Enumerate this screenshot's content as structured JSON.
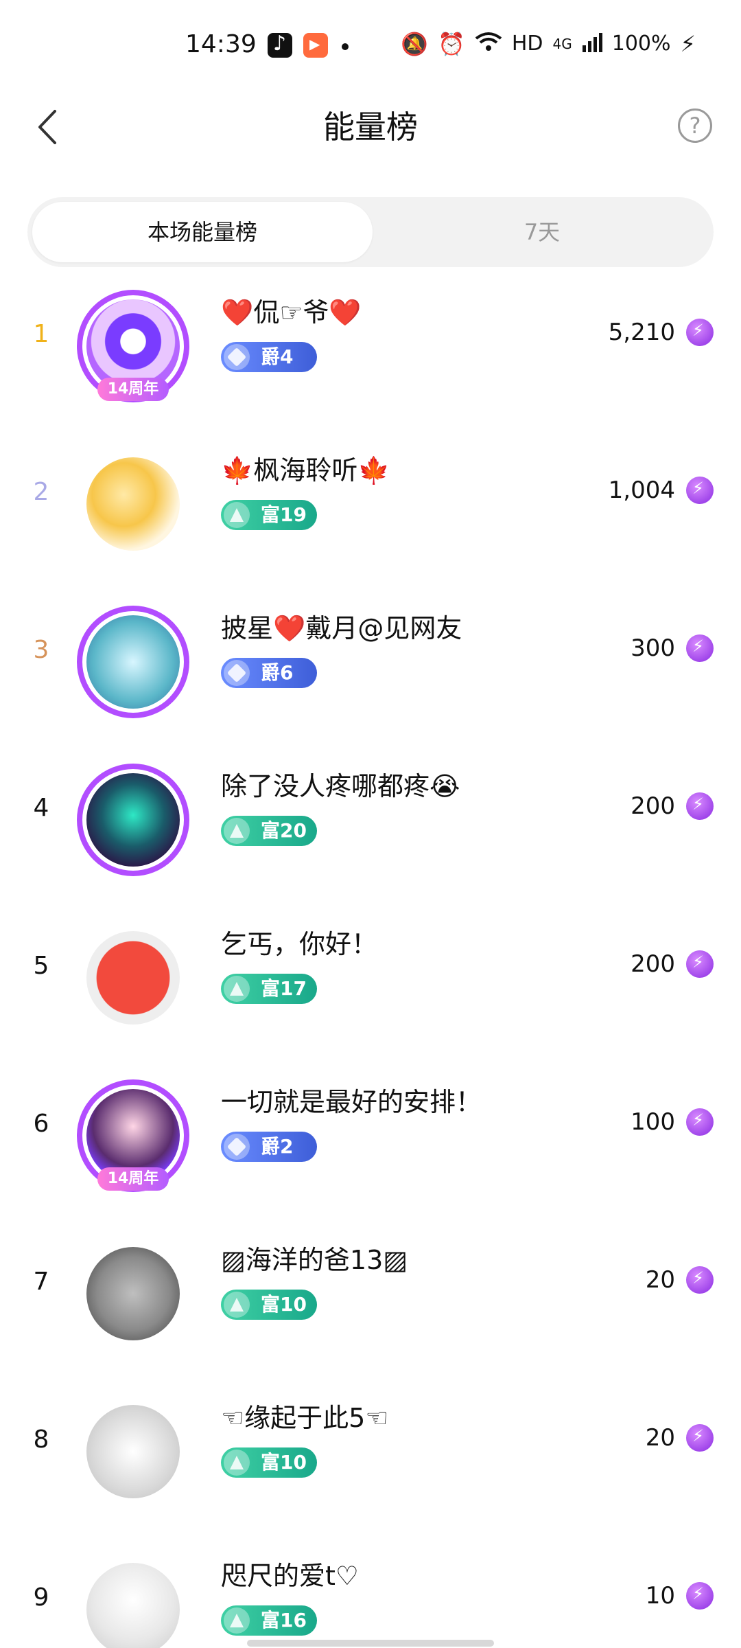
{
  "status_bar": {
    "time": "14:39",
    "network": "HD",
    "signal": "4G",
    "battery": "100%"
  },
  "header": {
    "title": "能量榜",
    "back_icon": "chevron-left-icon",
    "help_icon": "question-icon",
    "help_symbol": "?"
  },
  "tabs": [
    {
      "label": "本场能量榜",
      "active": true
    },
    {
      "label": "7天",
      "active": false
    }
  ],
  "ranking": [
    {
      "rank": "1",
      "name": "❤️侃☞爷❤️",
      "badge": "爵4",
      "badge_type": "jue",
      "score": "5,210",
      "avatar_overlay": "14周年",
      "rank_color": "#f0b21a"
    },
    {
      "rank": "2",
      "name": "🍁枫海聆听🍁",
      "badge": "富19",
      "badge_type": "fu",
      "score": "1,004",
      "avatar_overlay": "",
      "rank_color": "#a9a9e6"
    },
    {
      "rank": "3",
      "name": "披星❤️戴月@见网友",
      "badge": "爵6",
      "badge_type": "jue",
      "score": "300",
      "avatar_overlay": "",
      "rank_color": "#d6935a"
    },
    {
      "rank": "4",
      "name": "除了没人疼哪都疼😭",
      "badge": "富20",
      "badge_type": "fu",
      "score": "200",
      "avatar_overlay": "",
      "rank_color": "#111111"
    },
    {
      "rank": "5",
      "name": "乞丐，你好！",
      "badge": "富17",
      "badge_type": "fu",
      "score": "200",
      "avatar_overlay": "",
      "rank_color": "#111111"
    },
    {
      "rank": "6",
      "name": "一切就是最好的安排！",
      "badge": "爵2",
      "badge_type": "jue",
      "score": "100",
      "avatar_overlay": "14周年",
      "rank_color": "#111111"
    },
    {
      "rank": "7",
      "name": "▨海洋的爸13▨",
      "badge": "富10",
      "badge_type": "fu",
      "score": "20",
      "avatar_overlay": "",
      "rank_color": "#111111"
    },
    {
      "rank": "8",
      "name": "☜缘起于此5☜",
      "badge": "富10",
      "badge_type": "fu",
      "score": "20",
      "avatar_overlay": "",
      "rank_color": "#111111"
    },
    {
      "rank": "9",
      "name": "咫尺的爱t♡",
      "badge": "富16",
      "badge_type": "fu",
      "score": "10",
      "avatar_overlay": "",
      "rank_color": "#111111"
    }
  ],
  "colors": {
    "energy_icon": "#8a2be2",
    "jue_badge": "#4a6ce0",
    "fu_badge": "#22b08f"
  }
}
